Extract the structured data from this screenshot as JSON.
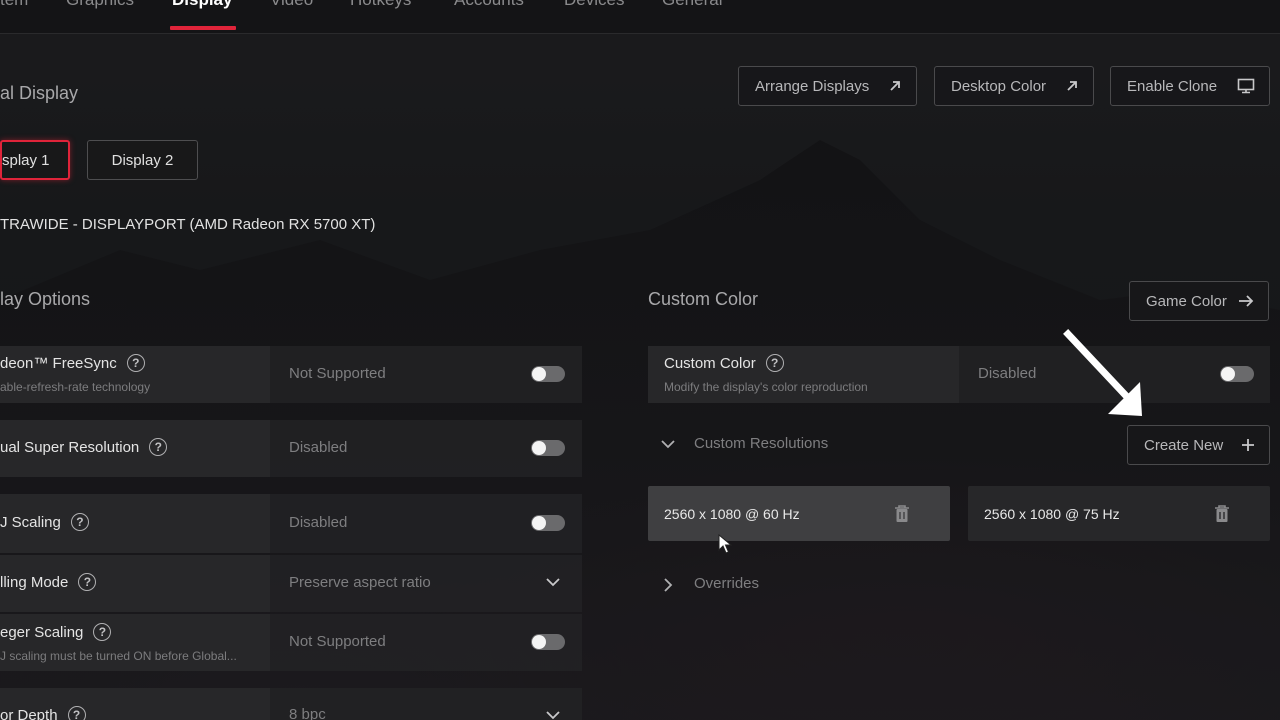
{
  "nav": {
    "tabs": [
      {
        "label": "tem"
      },
      {
        "label": "Graphics"
      },
      {
        "label": "Display",
        "active": true
      },
      {
        "label": "Video"
      },
      {
        "label": "Hotkeys"
      },
      {
        "label": "Accounts"
      },
      {
        "label": "Devices"
      },
      {
        "label": "General"
      }
    ],
    "accent_color": "#e0243a"
  },
  "header": {
    "title": "al Display",
    "buttons": {
      "arrange": "Arrange Displays",
      "desktop_color": "Desktop Color",
      "enable_clone": "Enable Clone"
    }
  },
  "displays": {
    "display1": "splay 1",
    "display2": "Display 2",
    "device_name": "TRAWIDE - DISPLAYPORT (AMD Radeon RX 5700 XT)"
  },
  "display_options": {
    "title": "lay Options",
    "rows": [
      {
        "title": "deon™ FreeSync",
        "subtitle": "able-refresh-rate technology",
        "value": "Not Supported",
        "control": "toggle"
      },
      {
        "title": "ual Super Resolution",
        "subtitle": "",
        "value": "Disabled",
        "control": "toggle"
      },
      {
        "title": "J Scaling",
        "subtitle": "",
        "value": "Disabled",
        "control": "toggle"
      },
      {
        "title": "lling Mode",
        "subtitle": "",
        "value": "Preserve aspect ratio",
        "control": "dropdown"
      },
      {
        "title": "eger Scaling",
        "subtitle": "J scaling must be turned ON before Global...",
        "value": "Not Supported",
        "control": "toggle"
      },
      {
        "title": "or Depth",
        "subtitle": "",
        "value": "8 bpc",
        "control": "dropdown"
      }
    ],
    "help_glyph": "?"
  },
  "custom_color": {
    "section_title": "Custom Color",
    "game_color_button": "Game Color",
    "row_title": "Custom Color",
    "row_subtitle": "Modify the display's color reproduction",
    "row_value": "Disabled"
  },
  "custom_resolutions": {
    "label": "Custom Resolutions",
    "create_new": "Create New",
    "items": [
      {
        "label": "2560 x 1080 @ 60 Hz"
      },
      {
        "label": "2560 x 1080 @ 75 Hz"
      }
    ]
  },
  "overrides": {
    "label": "Overrides"
  }
}
